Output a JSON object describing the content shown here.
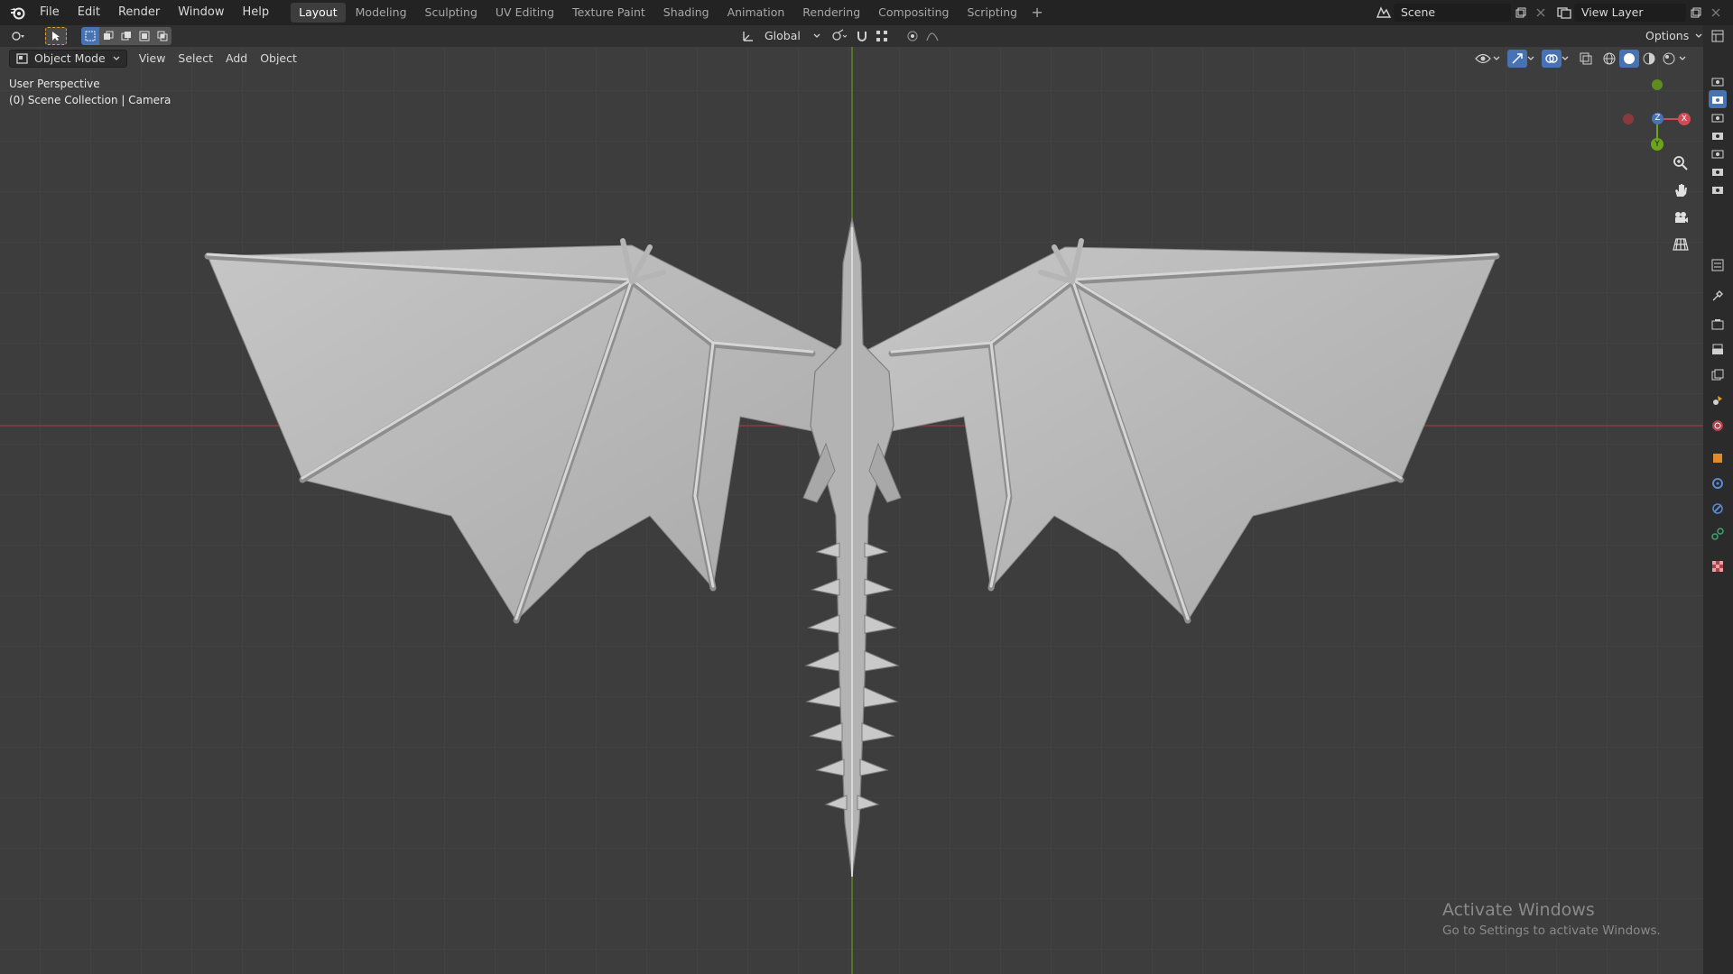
{
  "menu": [
    "File",
    "Edit",
    "Render",
    "Window",
    "Help"
  ],
  "workspaces": [
    "Layout",
    "Modeling",
    "Sculpting",
    "UV Editing",
    "Texture Paint",
    "Shading",
    "Animation",
    "Rendering",
    "Compositing",
    "Scripting"
  ],
  "active_workspace": "Layout",
  "workspace_add": "+",
  "scene_name": "Scene",
  "view_layer": "View Layer",
  "toolbar": {
    "transform_orientation": "Global",
    "options": "Options"
  },
  "header": {
    "mode": "Object Mode",
    "view": "View",
    "select": "Select",
    "add": "Add",
    "object": "Object"
  },
  "viewport": {
    "perspective": "User Perspective",
    "collection": "(0) Scene Collection | Camera"
  },
  "gizmo": {
    "x": "X",
    "y": "Y",
    "z": "Z"
  },
  "colors": {
    "topbar": "#232323",
    "viewport_bg": "#3d3d3d",
    "x_axis": "#b5404a",
    "y_axis": "#6ca41a",
    "accent_blue": "#4772b3"
  },
  "watermark": {
    "title": "Activate Windows",
    "subtitle": "Go to Settings to activate Windows."
  }
}
